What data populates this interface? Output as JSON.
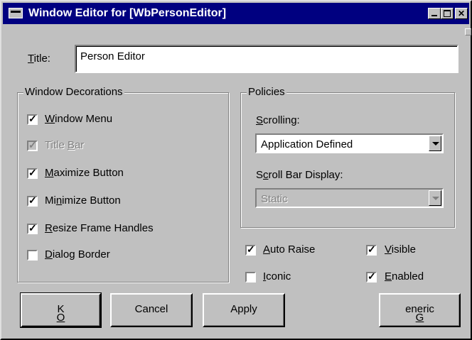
{
  "window": {
    "title": "Window Editor for [WbPersonEditor]",
    "caption_buttons": [
      "minimize-icon",
      "maximize-icon",
      "close-icon"
    ],
    "title_bar_color": "#000080"
  },
  "title_field": {
    "label": "Title:",
    "value": "Person Editor"
  },
  "decorations": {
    "legend": "Window Decorations",
    "items": [
      {
        "label": "Window Menu",
        "checked": true,
        "disabled": false
      },
      {
        "label": "Title Bar",
        "checked": true,
        "disabled": true
      },
      {
        "label": "Maximize Button",
        "checked": true,
        "disabled": false
      },
      {
        "label": "Minimize Button",
        "checked": true,
        "disabled": false
      },
      {
        "label": "Resize Frame Handles",
        "checked": true,
        "disabled": false
      },
      {
        "label": "Dialog Border",
        "checked": false,
        "disabled": false
      }
    ]
  },
  "policies": {
    "legend": "Policies",
    "scrolling_label": "Scrolling:",
    "scrolling_value": "Application Defined",
    "scrollbar_label": "Scroll Bar Display:",
    "scrollbar_value": "Static"
  },
  "options": [
    {
      "label": "Auto Raise",
      "checked": true
    },
    {
      "label": "Visible",
      "checked": true
    },
    {
      "label": "Iconic",
      "checked": false
    },
    {
      "label": "Enabled",
      "checked": true
    }
  ],
  "buttons": {
    "ok": "OK",
    "cancel": "Cancel",
    "apply": "Apply",
    "generic": "Generic"
  }
}
